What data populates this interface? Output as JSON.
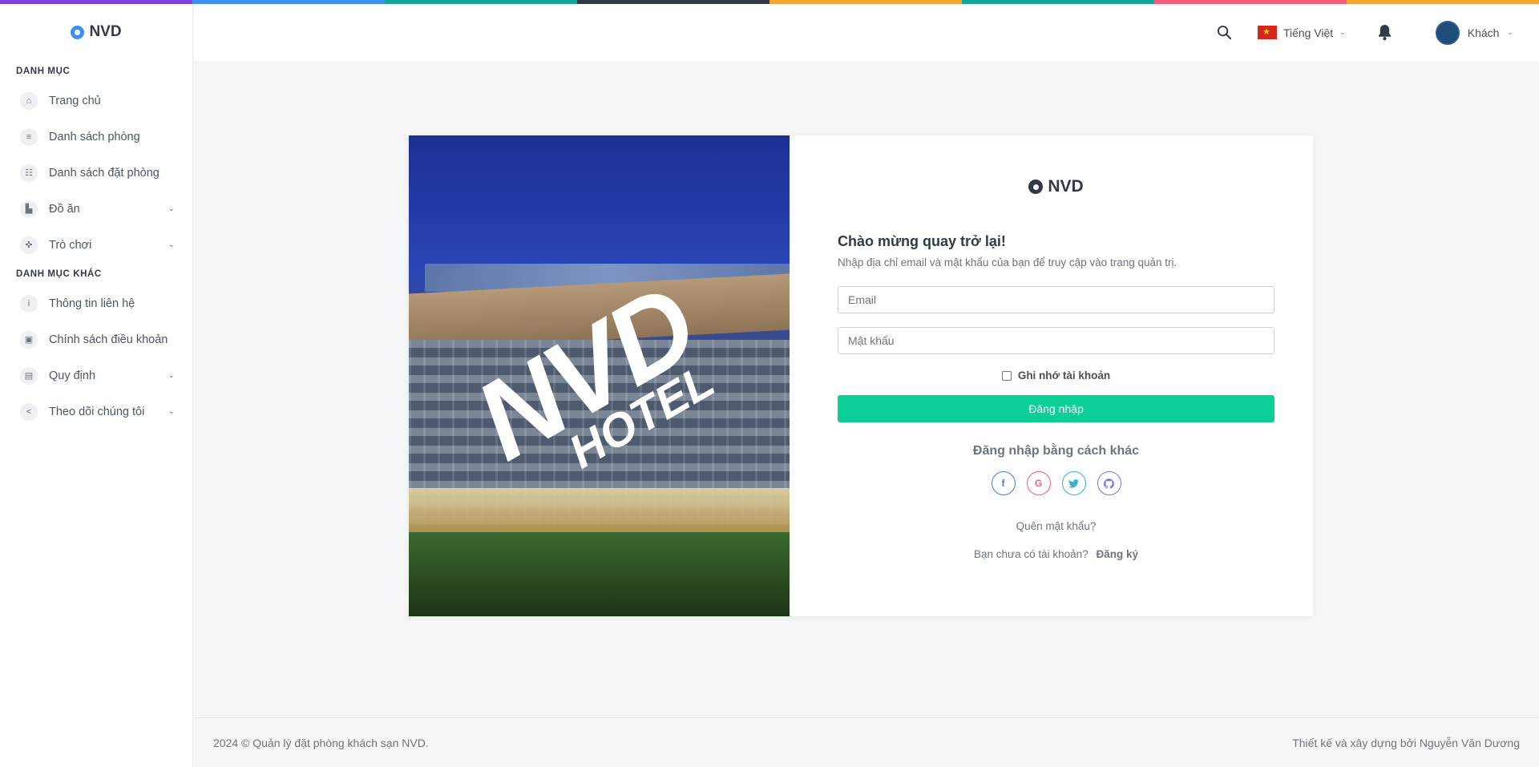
{
  "brand": "NVD",
  "top_stripe_colors": [
    "#7b3fe4",
    "#3d8ef8",
    "#16a596",
    "#313a46",
    "#f4a431",
    "#16a596",
    "#fa5c7c",
    "#f4a431"
  ],
  "sidebar": {
    "section1_title": "DANH MỤC",
    "section1_items": [
      {
        "label": "Trang chủ",
        "icon": "home-icon",
        "has_children": false
      },
      {
        "label": "Danh sách phòng",
        "icon": "list-icon",
        "has_children": false
      },
      {
        "label": "Danh sách đặt phòng",
        "icon": "booking-icon",
        "has_children": false
      },
      {
        "label": "Đồ ăn",
        "icon": "food-icon",
        "has_children": true
      },
      {
        "label": "Trò chơi",
        "icon": "game-icon",
        "has_children": true
      }
    ],
    "section2_title": "DANH MỤC KHÁC",
    "section2_items": [
      {
        "label": "Thông tin liên hệ",
        "icon": "info-icon",
        "has_children": false
      },
      {
        "label": "Chính sách điều khoản",
        "icon": "policy-icon",
        "has_children": false
      },
      {
        "label": "Quy định",
        "icon": "rules-icon",
        "has_children": true
      },
      {
        "label": "Theo dõi chúng tôi",
        "icon": "share-icon",
        "has_children": true
      }
    ]
  },
  "topbar": {
    "language": "Tiếng Việt",
    "user": "Khách"
  },
  "hero": {
    "watermark_big": "NVD",
    "watermark_small": "HOTEL"
  },
  "login": {
    "brand": "NVD",
    "welcome": "Chào mừng quay trở lại!",
    "subtitle": "Nhập địa chỉ email và mật khẩu của bạn để truy cập vào trang quản trị.",
    "email_placeholder": "Email",
    "password_placeholder": "Mật khẩu",
    "remember_label": "Ghi nhớ tài khoản",
    "submit_label": "Đăng nhập",
    "alt_title": "Đăng nhập bằng cách khác",
    "socials": [
      "facebook-icon",
      "google-icon",
      "twitter-icon",
      "github-icon"
    ],
    "forgot": "Quên mật khẩu?",
    "no_account": "Bạn chưa có tài khoản?",
    "signup": "Đăng ký"
  },
  "footer": {
    "left": "2024 © Quản lý đặt phòng khách sạn NVD.",
    "right": "Thiết kế và xây dựng bởi Nguyễn Văn Dương"
  }
}
